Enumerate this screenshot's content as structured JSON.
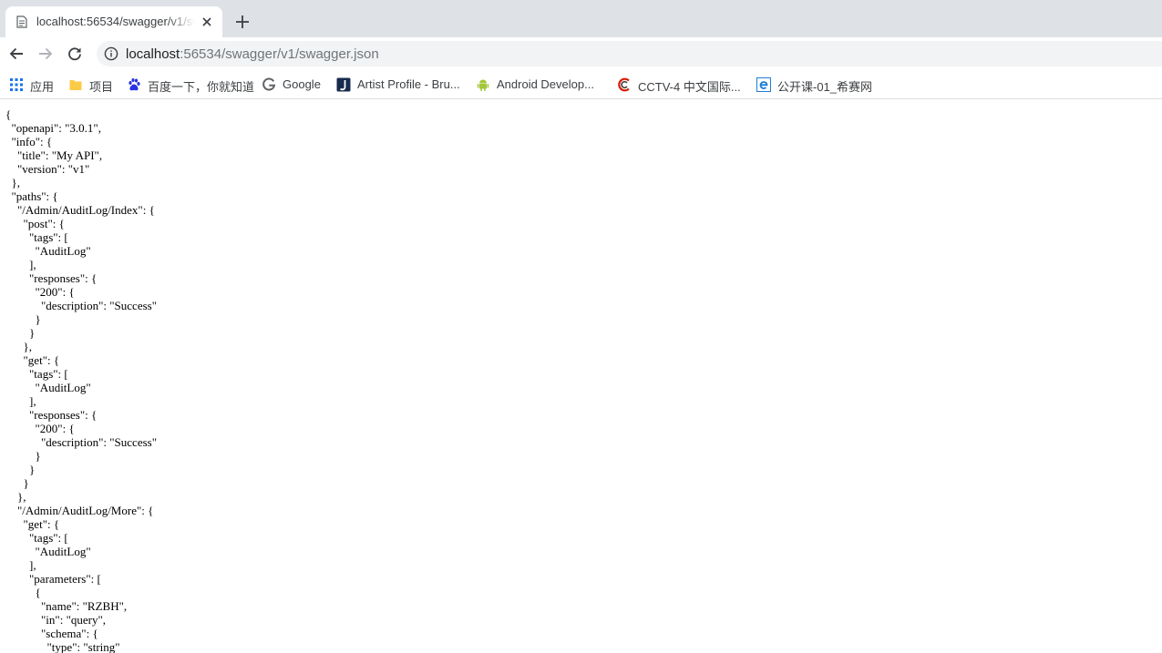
{
  "tab": {
    "title": "localhost:56534/swagger/v1/swagger.json",
    "icon": "document-icon",
    "close_icon": "close-icon"
  },
  "toolbar": {
    "back_icon": "arrow-left-icon",
    "forward_icon": "arrow-right-icon",
    "reload_icon": "reload-icon",
    "info_icon": "info-icon",
    "url_host": "localhost",
    "url_rest": ":56534/swagger/v1/swagger.json"
  },
  "bookmarks": [
    {
      "label": "应用",
      "icon": "apps-grid-icon"
    },
    {
      "label": "项目",
      "icon": "folder-icon"
    },
    {
      "label": "百度一下，你就知道",
      "icon": "baidu-paw-icon"
    },
    {
      "label": "Google",
      "icon": "google-icon"
    },
    {
      "label": "Artist Profile - Bru...",
      "icon": "jira-icon"
    },
    {
      "label": "Android Develop...",
      "icon": "android-icon"
    },
    {
      "label": "CCTV-4 中文国际...",
      "icon": "cctv-icon"
    },
    {
      "label": "公开课-01_希赛网",
      "icon": "ie-icon"
    }
  ],
  "colors": {
    "tabstrip": "#dee1e6",
    "omnibox": "#f1f3f4",
    "folder": "#fbcb48",
    "baidu": "#2932e1",
    "android": "#a4c639",
    "cctv": "#d81e06",
    "ie": "#1e7ed7"
  },
  "json_lines": [
    "{",
    "  \"openapi\": \"3.0.1\",",
    "  \"info\": {",
    "    \"title\": \"My API\",",
    "    \"version\": \"v1\"",
    "  },",
    "  \"paths\": {",
    "    \"/Admin/AuditLog/Index\": {",
    "      \"post\": {",
    "        \"tags\": [",
    "          \"AuditLog\"",
    "        ],",
    "        \"responses\": {",
    "          \"200\": {",
    "            \"description\": \"Success\"",
    "          }",
    "        }",
    "      },",
    "      \"get\": {",
    "        \"tags\": [",
    "          \"AuditLog\"",
    "        ],",
    "        \"responses\": {",
    "          \"200\": {",
    "            \"description\": \"Success\"",
    "          }",
    "        }",
    "      }",
    "    },",
    "    \"/Admin/AuditLog/More\": {",
    "      \"get\": {",
    "        \"tags\": [",
    "          \"AuditLog\"",
    "        ],",
    "        \"parameters\": [",
    "          {",
    "            \"name\": \"RZBH\",",
    "            \"in\": \"query\",",
    "            \"schema\": {",
    "              \"type\": \"string\""
  ]
}
